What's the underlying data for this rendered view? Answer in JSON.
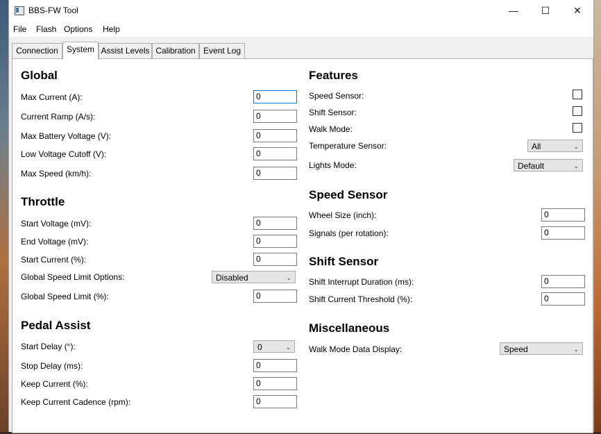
{
  "window": {
    "title": "BBS-FW Tool",
    "controls": [
      "—",
      "☐",
      "✕"
    ]
  },
  "menu": [
    "File",
    "Flash",
    "Options",
    "Help"
  ],
  "tabs": [
    "Connection",
    "System",
    "Assist Levels",
    "Calibration",
    "Event Log"
  ],
  "active_tab": "System",
  "global": {
    "heading": "Global",
    "fields": [
      {
        "label": "Max Current (A):",
        "value": "0"
      },
      {
        "label": "Current Ramp (A/s):",
        "value": "0"
      },
      {
        "label": "Max Battery Voltage (V):",
        "value": "0"
      },
      {
        "label": "Low Voltage Cutoff (V):",
        "value": "0"
      },
      {
        "label": "Max Speed (km/h):",
        "value": "0"
      }
    ]
  },
  "throttle": {
    "heading": "Throttle",
    "fields": [
      {
        "label": "Start Voltage (mV):",
        "value": "0"
      },
      {
        "label": "End Voltage (mV):",
        "value": "0"
      },
      {
        "label": "Start Current (%):",
        "value": "0"
      },
      {
        "label": "Global Speed Limit Options:",
        "value": "Disabled"
      },
      {
        "label": "Global Speed Limit (%):",
        "value": "0"
      }
    ]
  },
  "pedal_assist": {
    "heading": "Pedal Assist",
    "fields": [
      {
        "label": "Start Delay (°):",
        "value": "0"
      },
      {
        "label": "Stop Delay (ms):",
        "value": "0"
      },
      {
        "label": "Keep Current (%):",
        "value": "0"
      },
      {
        "label": "Keep Current Cadence (rpm):",
        "value": "0"
      }
    ]
  },
  "features": {
    "heading": "Features",
    "fields": [
      {
        "label": "Speed Sensor:",
        "checked": false
      },
      {
        "label": "Shift Sensor:",
        "checked": false
      },
      {
        "label": "Walk Mode:",
        "checked": false
      },
      {
        "label": "Temperature Sensor:",
        "value": "All"
      },
      {
        "label": "Lights Mode:",
        "value": "Default"
      }
    ]
  },
  "speed_sensor": {
    "heading": "Speed Sensor",
    "fields": [
      {
        "label": "Wheel Size (inch):",
        "value": "0"
      },
      {
        "label": "Signals (per rotation):",
        "value": "0"
      }
    ]
  },
  "shift_sensor": {
    "heading": "Shift Sensor",
    "fields": [
      {
        "label": "Shift Interrupt Duration (ms):",
        "value": "0"
      },
      {
        "label": "Shift Current Threshold (%):",
        "value": "0"
      }
    ]
  },
  "misc": {
    "heading": "Miscellaneous",
    "fields": [
      {
        "label": "Walk Mode Data Display:",
        "value": "Speed"
      }
    ]
  },
  "dropdown_arrow": "⌄"
}
